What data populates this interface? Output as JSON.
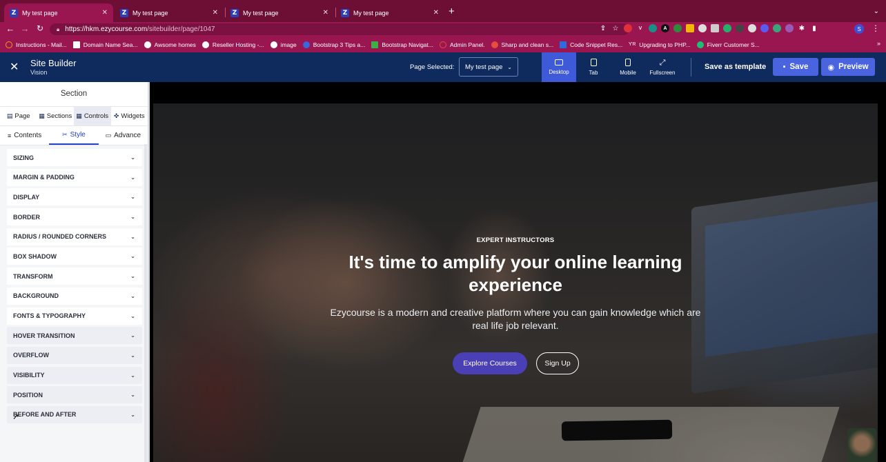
{
  "browser": {
    "tabs": [
      {
        "title": "My test page",
        "favicon": "Z",
        "active": true
      },
      {
        "title": "My test page",
        "favicon": "Z",
        "active": false
      },
      {
        "title": "My test page",
        "favicon": "Z",
        "active": false
      },
      {
        "title": "My test page",
        "favicon": "Z",
        "active": false
      }
    ],
    "new_tab_glyph": "+",
    "close_glyph": "✕",
    "tab_menu_glyph": "⌄",
    "url_host": "https://hkm.ezycourse.com",
    "url_path": "/sitebuilder/page/1047",
    "profile_initial": "S",
    "bookmarks": [
      "Instructions - Mail...",
      "Domain Name Sea...",
      "Awsome homes",
      "Reseller Hosting -...",
      "image",
      "Bootstrap 3 Tips a...",
      "Bootstrap Navigat...",
      "Admin Panel.",
      "Sharp and clean s...",
      "Code Snippet Res...",
      "Upgrading to PHP...",
      "Fiverr Customer S..."
    ],
    "bookmarks_more": "»",
    "colors": {
      "tabstrip": "#6d0f35",
      "toolbar": "#9a1650"
    }
  },
  "builder": {
    "title": "Site Builder",
    "subtitle": "Vision",
    "page_selected_label": "Page Selected:",
    "page_selected_value": "My test page",
    "devices": [
      {
        "label": "Desktop",
        "icon": "monitor-icon",
        "active": true
      },
      {
        "label": "Tab",
        "icon": "tablet-icon",
        "active": false
      },
      {
        "label": "Mobile",
        "icon": "mobile-icon",
        "active": false
      },
      {
        "label": "Fullscreen",
        "icon": "expand-icon",
        "active": false
      }
    ],
    "save_as_template": "Save as template",
    "save": "Save",
    "preview": "Preview",
    "colors": {
      "header": "#0f2a5c",
      "accent": "#4a64e0"
    }
  },
  "panel": {
    "heading": "Section",
    "main_tabs": [
      {
        "label": "Page",
        "icon": "page-icon"
      },
      {
        "label": "Sections",
        "icon": "sections-icon"
      },
      {
        "label": "Controls",
        "icon": "controls-icon",
        "active": true
      },
      {
        "label": "Widgets",
        "icon": "widgets-icon"
      }
    ],
    "sub_tabs": [
      {
        "label": "Contents",
        "icon": "list-icon"
      },
      {
        "label": "Style",
        "icon": "brush-icon",
        "active": true
      },
      {
        "label": "Advance",
        "icon": "monitor-icon"
      }
    ],
    "sections": [
      "SIZING",
      "MARGIN & PADDING",
      "DISPLAY",
      "BORDER",
      "RADIUS / ROUNDED CORNERS",
      "BOX SHADOW",
      "TRANSFORM",
      "BACKGROUND",
      "FONTS & TYPOGRAPHY",
      "HOVER TRANSITION",
      "OVERFLOW",
      "VISIBILITY",
      "POSITION",
      "BEFORE AND AFTER"
    ]
  },
  "hero": {
    "eyebrow": "EXPERT INSTRUCTORS",
    "title": "It's time to amplify your online learning experience",
    "description": "Ezycourse is a modern and creative platform where you can gain knowledge which are real life job relevant.",
    "primary_button": "Explore Courses",
    "secondary_button": "Sign Up",
    "colors": {
      "primary_button": "#4a3fb5"
    }
  }
}
